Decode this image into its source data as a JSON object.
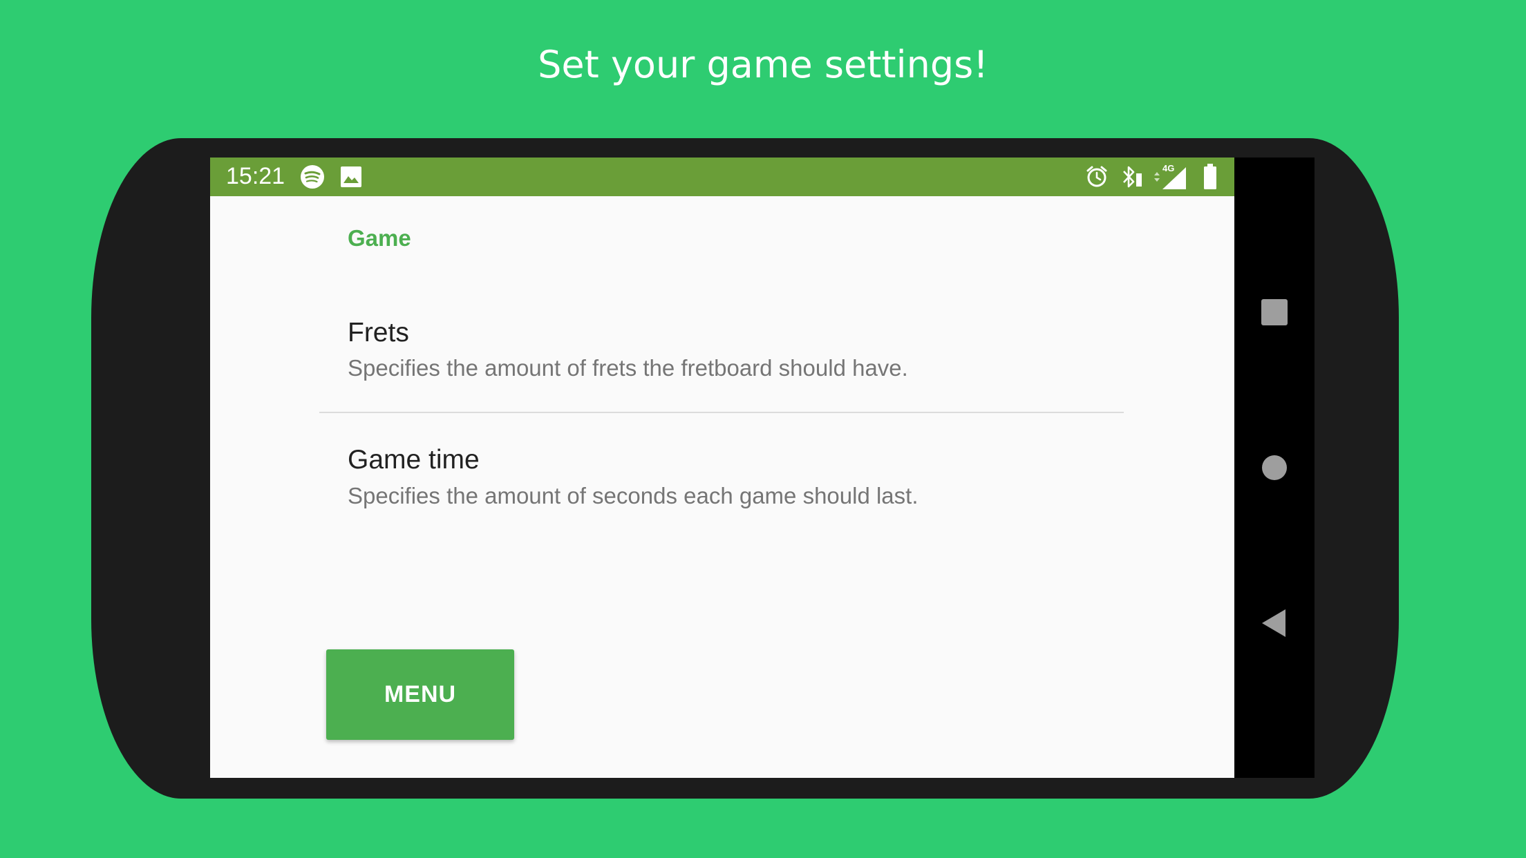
{
  "headline": "Set your game settings!",
  "status_bar": {
    "time": "15:21",
    "network_label": "4G",
    "left_icons": [
      "spotify-icon",
      "image-icon"
    ],
    "right_icons": [
      "alarm-icon",
      "bluetooth-icon",
      "signal-icon",
      "battery-icon"
    ],
    "background": "#6a9e38"
  },
  "settings": {
    "category": "Game",
    "items": [
      {
        "title": "Frets",
        "summary": "Specifies the amount of frets the fretboard should have."
      },
      {
        "title": "Game time",
        "summary": "Specifies the amount of seconds each game should last."
      }
    ]
  },
  "menu_button": {
    "label": "MENU"
  },
  "nav_bar": {
    "buttons": [
      "recents-icon",
      "home-icon",
      "back-icon"
    ]
  },
  "colors": {
    "page_background": "#2ecc71",
    "accent": "#4caf50",
    "device_frame": "#1c1c1c"
  }
}
